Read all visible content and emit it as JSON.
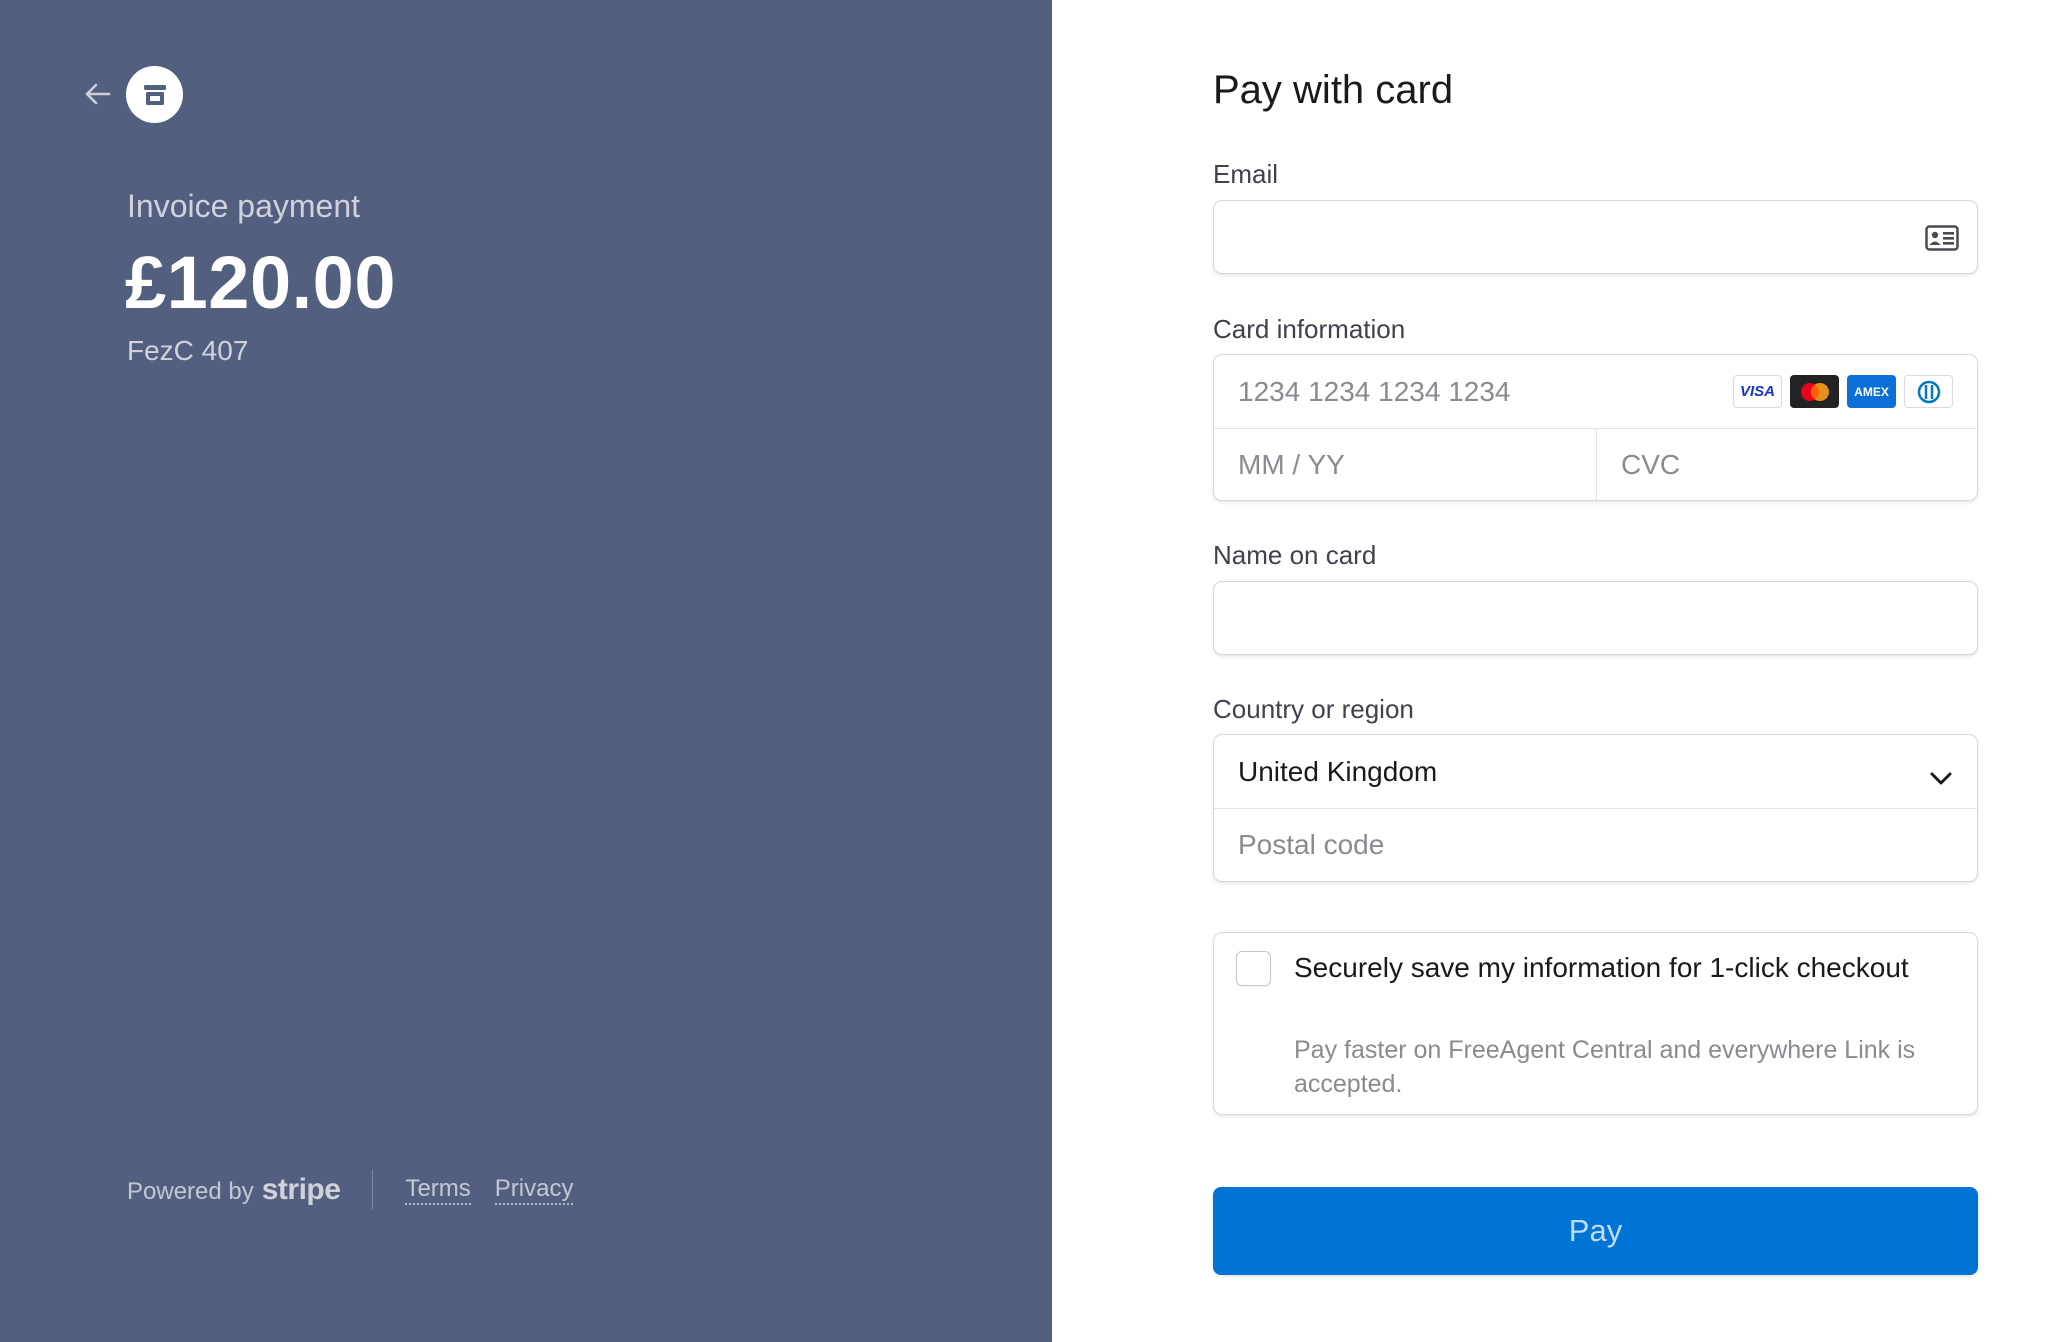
{
  "summary": {
    "label": "Invoice payment",
    "amount": "£120.00",
    "reference": "FezC 407"
  },
  "footer": {
    "powered_by": "Powered by",
    "brand": "stripe",
    "terms": "Terms",
    "privacy": "Privacy"
  },
  "form": {
    "title": "Pay with card",
    "email": {
      "label": "Email",
      "value": "",
      "placeholder": ""
    },
    "card": {
      "label": "Card information",
      "number_placeholder": "1234 1234 1234 1234",
      "expiry_placeholder": "MM / YY",
      "cvc_placeholder": "CVC",
      "brands": [
        "VISA",
        "mastercard",
        "AMEX",
        "diners"
      ]
    },
    "name": {
      "label": "Name on card",
      "value": ""
    },
    "country": {
      "label": "Country or region",
      "selected": "United Kingdom",
      "postal_placeholder": "Postal code"
    },
    "save": {
      "title": "Securely save my information for 1-click checkout",
      "description": "Pay faster on FreeAgent Central and everywhere Link is accepted.",
      "checked": false
    },
    "pay_label": "Pay"
  },
  "colors": {
    "left_panel": "#525f7f",
    "pay_button": "#0074d4"
  }
}
